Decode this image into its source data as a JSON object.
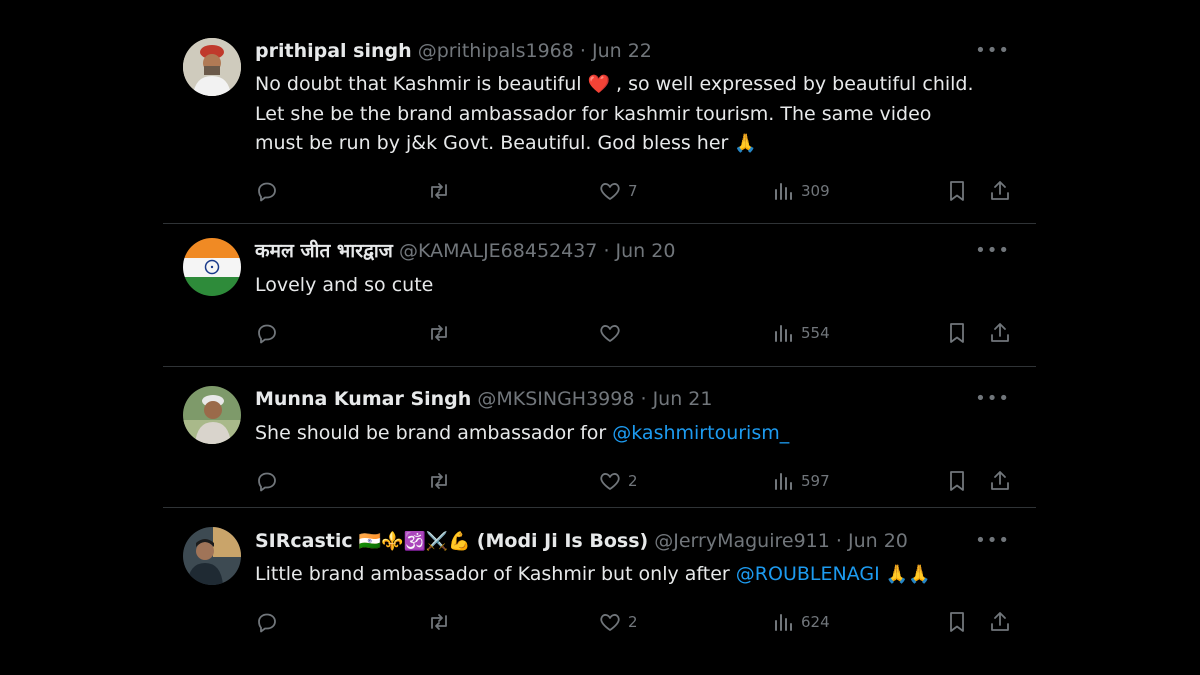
{
  "replies": [
    {
      "name": "prithipal singh",
      "handle": "@prithipals1968",
      "separator": "·",
      "date": "Jun 22",
      "text_parts": [
        "No doubt that Kashmir is beautiful ",
        "❤️",
        " , so well expressed by beautiful child. Let she be the brand ambassador for kashmir tourism. The same video must be run by j&k Govt. Beautiful. God bless her ",
        "🙏"
      ],
      "likes": "7",
      "views": "309",
      "avatar": "person-avatar"
    },
    {
      "name": "कमल जीत भारद्वाज",
      "handle": "@KAMALJE68452437",
      "separator": "·",
      "date": "Jun 20",
      "text": "Lovely and so cute",
      "likes": "",
      "views": "554",
      "avatar": "india-flag-avatar"
    },
    {
      "name": "Munna Kumar Singh",
      "handle": "@MKSINGH3998",
      "separator": "·",
      "date": "Jun 21",
      "text": "She should be brand ambassador for ",
      "mention": "@kashmirtourism_",
      "likes": "2",
      "views": "597",
      "avatar": "person-avatar"
    },
    {
      "name_prefix": "SIRcastic",
      "name_emojis": "🇮🇳⚜️🕉️⚔️💪",
      "name_suffix": "(Modi Ji Is Boss)",
      "handle": "@JerryMaguire911",
      "separator": "·",
      "date": "Jun 20",
      "text": "Little brand ambassador of Kashmir but only after ",
      "mention": "@ROUBLENAGI",
      "text_emojis": "🙏🙏",
      "likes": "2",
      "views": "624",
      "avatar": "person-avatar"
    }
  ],
  "more_label": "•••",
  "icons": {
    "reply": "reply-icon",
    "retweet": "retweet-icon",
    "like": "like-icon",
    "views": "views-icon",
    "bookmark": "bookmark-icon",
    "share": "share-icon"
  },
  "colors": {
    "background": "#000000",
    "text": "#e7e9ea",
    "secondary": "#71767b",
    "link": "#1d9bf0",
    "divider": "#2f3336",
    "heart": "#f91880"
  }
}
